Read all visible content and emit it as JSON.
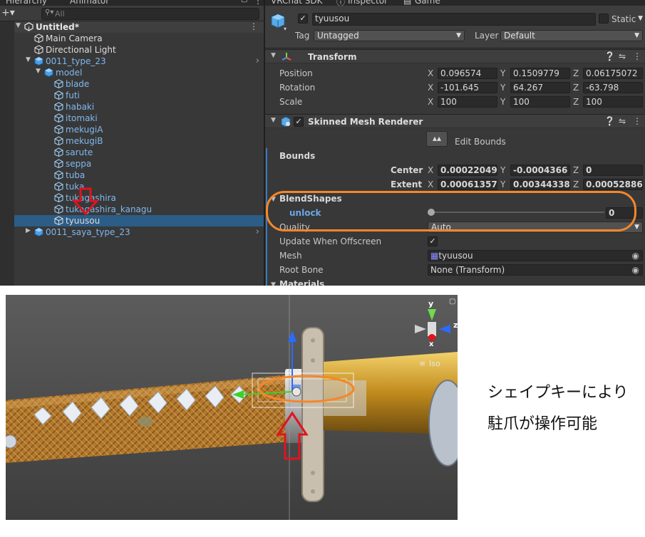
{
  "hierarchy": {
    "tabs": [
      "Hierarchy",
      "Animator"
    ],
    "search_placeholder": "All",
    "add_button": "+▾",
    "items": [
      {
        "label": "Untitled*",
        "icon": "unity-scene-icon",
        "style": "bold",
        "fold": "▼"
      },
      {
        "label": "Main Camera",
        "icon": "gameobject-cube-icon",
        "style": "white",
        "fold": ""
      },
      {
        "label": "Directional Light",
        "icon": "gameobject-cube-icon",
        "style": "white",
        "fold": ""
      },
      {
        "label": "0011_type_23",
        "icon": "prefab-cube-icon",
        "style": "blue",
        "fold": "▼",
        "chevron": "›"
      },
      {
        "label": "model",
        "icon": "prefab-cube-icon",
        "style": "blue",
        "fold": "▼"
      },
      {
        "label": "blade",
        "icon": "gameobject-cube-icon",
        "style": "blue",
        "fold": ""
      },
      {
        "label": "futi",
        "icon": "gameobject-cube-icon",
        "style": "blue",
        "fold": ""
      },
      {
        "label": "habaki",
        "icon": "gameobject-cube-icon",
        "style": "blue",
        "fold": ""
      },
      {
        "label": "itomaki",
        "icon": "gameobject-cube-icon",
        "style": "blue",
        "fold": ""
      },
      {
        "label": "mekugiA",
        "icon": "gameobject-cube-icon",
        "style": "blue",
        "fold": ""
      },
      {
        "label": "mekugiB",
        "icon": "gameobject-cube-icon",
        "style": "blue",
        "fold": ""
      },
      {
        "label": "sarute",
        "icon": "gameobject-cube-icon",
        "style": "blue",
        "fold": ""
      },
      {
        "label": "seppa",
        "icon": "gameobject-cube-icon",
        "style": "blue",
        "fold": ""
      },
      {
        "label": "tuba",
        "icon": "gameobject-cube-icon",
        "style": "blue",
        "fold": ""
      },
      {
        "label": "tuka",
        "icon": "gameobject-cube-icon",
        "style": "blue",
        "fold": ""
      },
      {
        "label": "tukagashira",
        "icon": "gameobject-cube-icon",
        "style": "blue",
        "fold": ""
      },
      {
        "label": "tukagashira_kanagu",
        "icon": "gameobject-cube-icon",
        "style": "blue",
        "fold": ""
      },
      {
        "label": "tyuusou",
        "icon": "gameobject-cube-icon",
        "style": "white",
        "fold": "",
        "selected": true
      },
      {
        "label": "0011_saya_type_23",
        "icon": "prefab-cube-icon",
        "style": "blue",
        "fold": "▶",
        "chevron": "›"
      }
    ]
  },
  "inspector": {
    "tabs": [
      "VRChat SDK",
      "Inspector",
      "Game"
    ],
    "object_name": "tyuusou",
    "static_label": "Static",
    "tag_label": "Tag",
    "tag_value": "Untagged",
    "layer_label": "Layer",
    "layer_value": "Default",
    "transform": {
      "title": "Transform",
      "rows": [
        {
          "label": "Position",
          "x": "0.096574",
          "y": "0.1509779",
          "z": "0.06175072"
        },
        {
          "label": "Rotation",
          "x": "-101.645",
          "y": "64.267",
          "z": "-63.798"
        },
        {
          "label": "Scale",
          "x": "100",
          "y": "100",
          "z": "100"
        }
      ]
    },
    "smr": {
      "title": "Skinned Mesh Renderer",
      "edit_bounds": "Edit Bounds",
      "bounds_label": "Bounds",
      "center": {
        "label": "Center",
        "x": "0.00022049",
        "y": "-0.0004366",
        "z": "0"
      },
      "extent": {
        "label": "Extent",
        "x": "0.00061357",
        "y": "0.00344338",
        "z": "0.00052886"
      },
      "blendshapes_label": "BlendShapes",
      "blendshape_name": "unlock",
      "blendshape_value": "0",
      "blendshape_level": 0,
      "quality_label": "Quality",
      "quality_value": "Auto",
      "update_offscreen_label": "Update When Offscreen",
      "update_offscreen_checked": true,
      "mesh_label": "Mesh",
      "mesh_value": "tyuusou",
      "root_bone_label": "Root Bone",
      "root_bone_value": "None (Transform)",
      "materials_label": "Materials"
    },
    "axis_labels": {
      "x": "X",
      "y": "Y",
      "z": "Z"
    }
  },
  "scene": {
    "gizmo_y": "y",
    "gizmo_z": "z",
    "gizmo_x": "x",
    "iso_label": "Iso"
  },
  "caption": {
    "line1": "シェイプキーにより",
    "line2": "駐爪が操作可能"
  },
  "colors": {
    "panel_bg": "#383838",
    "selection": "#2c5d87",
    "prefab_blue": "#7fb8ef",
    "annotation_orange": "#f5862a",
    "annotation_red": "#e0141e",
    "handle_blue": "#2a6bff",
    "handle_green": "#3fd12a"
  }
}
